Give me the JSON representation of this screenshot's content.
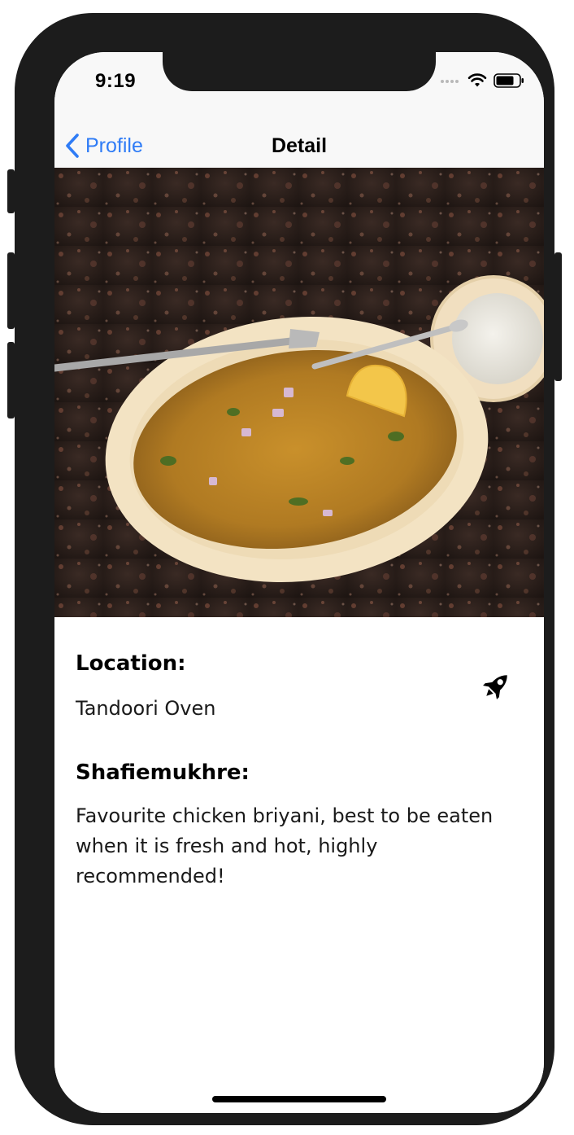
{
  "status_bar": {
    "time": "9:19",
    "icons": [
      "cellular-signal-icon",
      "wifi-icon",
      "battery-icon"
    ]
  },
  "navbar": {
    "back_label": "Profile",
    "title": "Detail"
  },
  "hero_image": {
    "alt": "chicken briyani on an oval plate with a lemon wedge and a side of raita"
  },
  "detail": {
    "location_label": "Location:",
    "location_value": "Tandoori Oven",
    "author_label": "Shafiemukhre:",
    "description": "Favourite chicken briyani, best to be eaten when it is fresh and hot, highly recommended!",
    "action_icon": "rocket-icon"
  },
  "colors": {
    "accent": "#2f7cf6",
    "device_frame": "#1c1c1c",
    "bar_background": "#f8f8f8"
  }
}
